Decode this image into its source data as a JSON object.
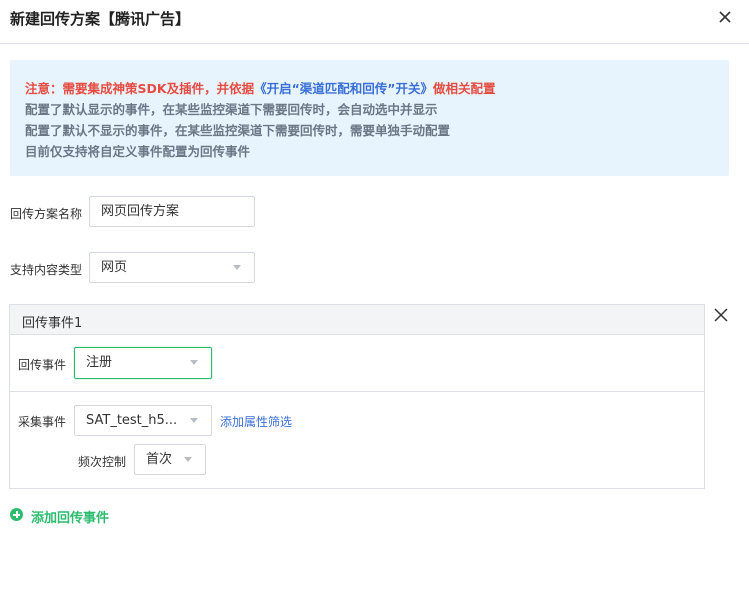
{
  "dialog": {
    "title": "新建回传方案【腾讯广告】"
  },
  "notice": {
    "line1_prefix": "注意：需要集成神策SDK及插件，并依据",
    "line1_link": "《开启“渠道匹配和回传”开关》",
    "line1_suffix": "做相关配置",
    "line2": "配置了默认显示的事件，在某些监控渠道下需要回传时，会自动选中并显示",
    "line3": "配置了默认不显示的事件，在某些监控渠道下需要回传时，需要单独手动配置",
    "line4": "目前仅支持将自定义事件配置为回传事件"
  },
  "form": {
    "scheme_name_label": "回传方案名称",
    "scheme_name_value": "网页回传方案",
    "content_type_label": "支持内容类型",
    "content_type_value": "网页"
  },
  "event": {
    "header": "回传事件1",
    "return_event_label": "回传事件",
    "return_event_value": "注册",
    "collect_event_label": "采集事件",
    "collect_event_value": "SAT_test_h5...",
    "add_filter_link": "添加属性筛选",
    "frequency_label": "频次控制",
    "frequency_value": "首次"
  },
  "add_event_button": "添加回传事件",
  "colors": {
    "accent_green": "#2dbc6e",
    "warning_red": "#e54d42",
    "link_blue": "#3a6fd8",
    "notice_bg": "#e8f4fd"
  },
  "icons": {
    "close": "close-icon",
    "remove_event": "remove-event-icon",
    "add": "plus-circle-icon",
    "dropdown": "chevron-down-icon"
  }
}
